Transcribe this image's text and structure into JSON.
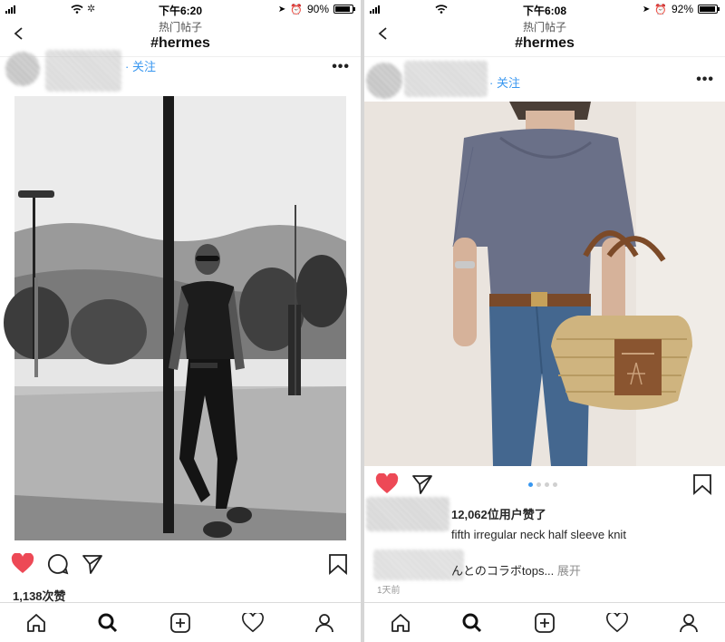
{
  "left": {
    "status": {
      "time": "下午6:20",
      "battery": "90%",
      "battery_level": 0.9
    },
    "nav": {
      "subtitle": "热门帖子",
      "title": "#hermes"
    },
    "post": {
      "follow_label": "· 关注",
      "likes": "1,138次赞"
    }
  },
  "right": {
    "status": {
      "time": "下午6:08",
      "battery": "92%",
      "battery_level": 0.92
    },
    "nav": {
      "subtitle": "热门帖子",
      "title": "#hermes"
    },
    "post": {
      "follow_label": "· 关注",
      "likes": "12,062位用户赞了",
      "caption_line1": "fifth irregular neck half sleeve knit",
      "caption_line2": "んとのコラボtops...",
      "caption_more": "展开",
      "timestamp": "1天前",
      "carousel": {
        "count": 4,
        "active": 1
      }
    }
  },
  "icons": {
    "back": "chevron-left-icon",
    "more": "more-horizontal-icon",
    "like": "heart-filled-icon",
    "comment": "comment-icon",
    "share": "send-icon",
    "save": "bookmark-icon",
    "home": "home-icon",
    "search": "search-icon",
    "add": "add-post-icon",
    "activity": "heart-outline-icon",
    "profile": "profile-icon"
  },
  "colors": {
    "like": "#ed4956",
    "link": "#3897f0",
    "active_dot": "#3897f0"
  }
}
